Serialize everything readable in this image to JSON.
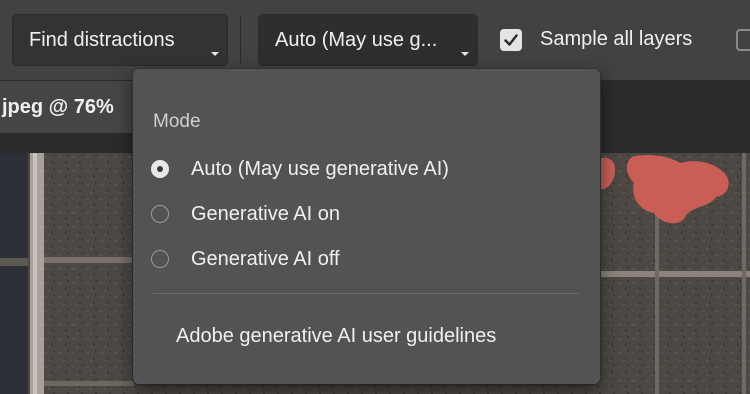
{
  "options_bar": {
    "find_button_label": "Find distractions",
    "mode_button_label": "Auto (May use g...",
    "sample_all_layers_label": "Sample all layers",
    "sample_all_layers_checked": true
  },
  "document_tab": {
    "title": "jpeg @ 76%"
  },
  "mode_dropdown": {
    "heading": "Mode",
    "options": [
      {
        "label": "Auto (May use generative AI)",
        "selected": true
      },
      {
        "label": "Generative AI on",
        "selected": false
      },
      {
        "label": "Generative AI off",
        "selected": false
      }
    ],
    "link_label": "Adobe generative AI user guidelines"
  },
  "colors": {
    "selection_highlight": "#d8605a",
    "popup_background": "#535353",
    "toolbar_background": "#424242"
  }
}
